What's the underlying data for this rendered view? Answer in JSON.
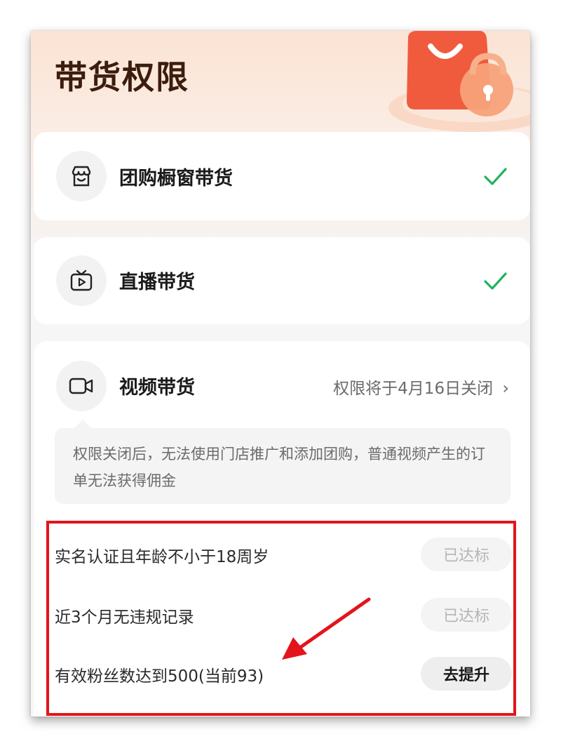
{
  "header": {
    "title": "带货权限"
  },
  "permissions": [
    {
      "label": "团购橱窗带货",
      "icon": "storefront-icon",
      "status": "enabled"
    },
    {
      "label": "直播带货",
      "icon": "tv-play-icon",
      "status": "enabled"
    },
    {
      "label": "视频带货",
      "icon": "video-camera-icon",
      "status_text": "权限将于4月16日关闭",
      "note": "权限关闭后，无法使用门店推广和添加团购，普通视频产生的订单无法获得佣金",
      "requirements": [
        {
          "label": "实名认证且年龄不小于18周岁",
          "action": "已达标",
          "done": true
        },
        {
          "label": "近3个月无违规记录",
          "action": "已达标",
          "done": true
        },
        {
          "label": "有效粉丝数达到500(当前93)",
          "action": "去提升",
          "done": false
        }
      ]
    }
  ],
  "colors": {
    "check": "#22b35e",
    "annotation": "#e3141b",
    "title": "#3b1d0e"
  }
}
